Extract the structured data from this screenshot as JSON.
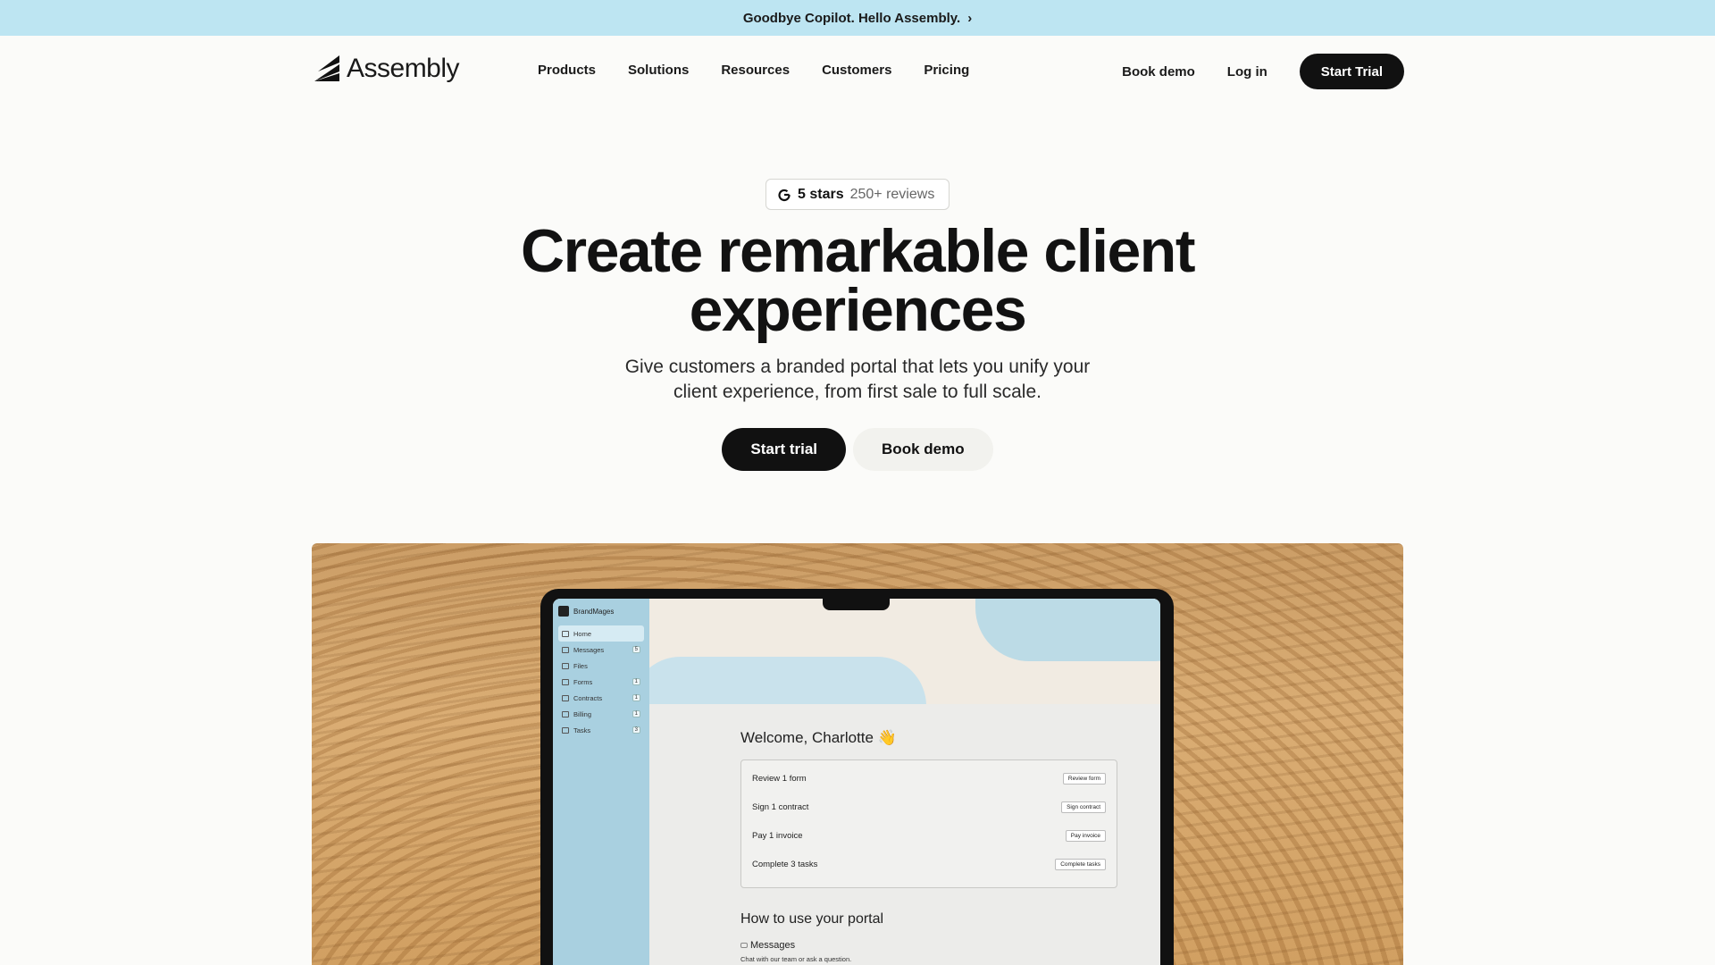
{
  "announcement": {
    "text": "Goodbye Copilot. Hello Assembly.",
    "chevron": "›"
  },
  "brand": {
    "name": "Assembly",
    "logo_icon": "assembly-logo-icon"
  },
  "nav": {
    "links": [
      "Products",
      "Solutions",
      "Resources",
      "Customers",
      "Pricing"
    ],
    "book_demo": "Book demo",
    "login": "Log in",
    "start_trial": "Start Trial"
  },
  "rating": {
    "icon": "g2-icon",
    "stars": "5 stars",
    "reviews": "250+ reviews"
  },
  "hero": {
    "title_line1": "Create remarkable client",
    "title_line2": "experiences",
    "subtitle_line1": "Give customers a branded portal that lets you unify your",
    "subtitle_line2": "client experience, from first sale to full scale.",
    "primary_cta": "Start trial",
    "secondary_cta": "Book demo"
  },
  "portal": {
    "brand": "BrandMages",
    "sidebar": [
      {
        "label": "Home",
        "icon": "home-icon",
        "count": ""
      },
      {
        "label": "Messages",
        "icon": "message-icon",
        "count": "5"
      },
      {
        "label": "Files",
        "icon": "folder-icon",
        "count": ""
      },
      {
        "label": "Forms",
        "icon": "form-icon",
        "count": "1"
      },
      {
        "label": "Contracts",
        "icon": "contract-icon",
        "count": "1"
      },
      {
        "label": "Billing",
        "icon": "billing-icon",
        "count": "1"
      },
      {
        "label": "Tasks",
        "icon": "tasks-icon",
        "count": "3"
      }
    ],
    "welcome": "Welcome, Charlotte 👋",
    "tasks": [
      {
        "label": "Review 1 form",
        "button": "Review form"
      },
      {
        "label": "Sign 1 contract",
        "button": "Sign contract"
      },
      {
        "label": "Pay 1 invoice",
        "button": "Pay invoice"
      },
      {
        "label": "Complete 3 tasks",
        "button": "Complete tasks"
      }
    ],
    "howto_title": "How to use your portal",
    "messages_heading": "Messages",
    "messages_desc": "Chat with our team or ask a question."
  },
  "colors": {
    "announce_bg": "#bde5f2",
    "dark": "#111111",
    "portal_sidebar": "#a9d0e0"
  }
}
